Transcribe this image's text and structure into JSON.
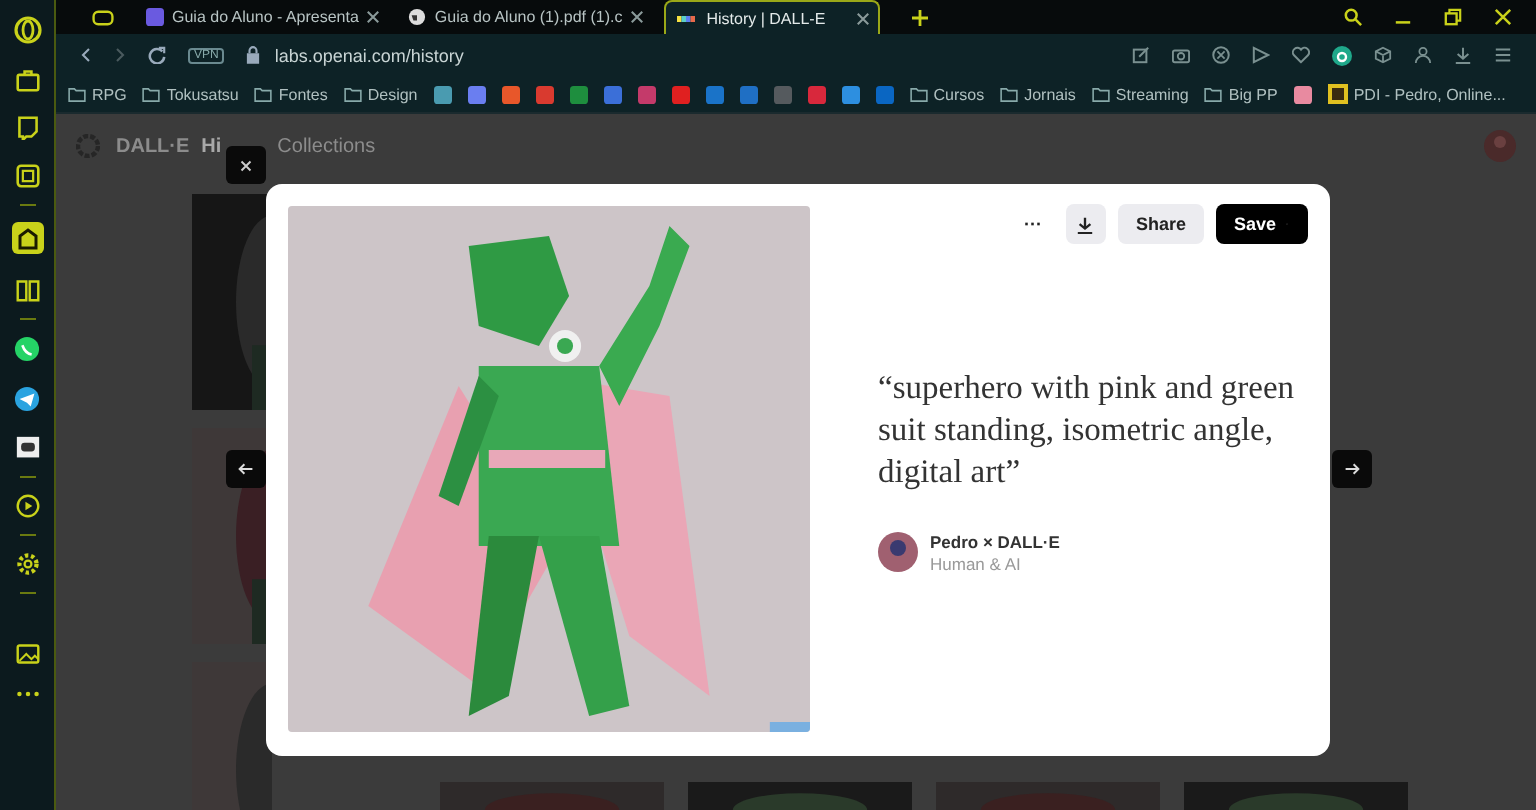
{
  "sidebar": {
    "items": [
      {
        "kind": "browser",
        "selected": false
      },
      {
        "kind": "bag",
        "selected": false
      },
      {
        "kind": "chat",
        "selected": false
      },
      {
        "kind": "box",
        "selected": false
      },
      {
        "kind": "home",
        "selected": true
      },
      {
        "kind": "book",
        "selected": false
      },
      {
        "kind": "whatsapp",
        "selected": false
      },
      {
        "kind": "telegram",
        "selected": false
      },
      {
        "kind": "discord",
        "selected": false
      },
      {
        "kind": "play",
        "selected": false
      },
      {
        "kind": "gear",
        "selected": false
      },
      {
        "kind": "gallery",
        "selected": false
      },
      {
        "kind": "more",
        "selected": false
      }
    ]
  },
  "tabs": [
    {
      "title": "Guia do Aluno - Apresenta",
      "selected": false,
      "kind": "app"
    },
    {
      "title": "Guia do Aluno (1).pdf (1).c",
      "selected": false,
      "kind": "globe"
    },
    {
      "title": "History | DALL-E",
      "selected": true,
      "kind": "dalle"
    }
  ],
  "address_bar": {
    "url": "labs.openai.com/history",
    "badge": "VPN"
  },
  "bookmarks": [
    {
      "kind": "folder",
      "label": "RPG"
    },
    {
      "kind": "folder",
      "label": "Tokusatsu"
    },
    {
      "kind": "folder",
      "label": "Fontes"
    },
    {
      "kind": "folder",
      "label": "Design"
    },
    {
      "kind": "site",
      "color": "#4a9bb0"
    },
    {
      "kind": "site",
      "color": "#6a7ef0"
    },
    {
      "kind": "site",
      "color": "#e8572a"
    },
    {
      "kind": "site",
      "color": "#d93a2f"
    },
    {
      "kind": "site",
      "color": "#1e8e3e"
    },
    {
      "kind": "site",
      "color": "#3b6fd8"
    },
    {
      "kind": "site",
      "color": "#c43a6a"
    },
    {
      "kind": "site",
      "color": "#e02020"
    },
    {
      "kind": "site",
      "color": "#1a73c8"
    },
    {
      "kind": "site",
      "color": "#1f6fc4"
    },
    {
      "kind": "site",
      "color": "#555a5e"
    },
    {
      "kind": "site",
      "color": "#d8283c"
    },
    {
      "kind": "site",
      "color": "#2d8fe0"
    },
    {
      "kind": "site",
      "color": "#0a66c2"
    },
    {
      "kind": "folder",
      "label": "Cursos"
    },
    {
      "kind": "folder",
      "label": "Jornais"
    },
    {
      "kind": "folder",
      "label": "Streaming"
    },
    {
      "kind": "folder",
      "label": "Big PP"
    },
    {
      "kind": "site",
      "color": "#e88aa0"
    },
    {
      "kind": "page",
      "label": "PDI - Pedro, Online..."
    }
  ],
  "page": {
    "brand": "DALL·E",
    "nav": [
      {
        "label": "Hi",
        "selected": true
      },
      {
        "label": "Collections",
        "selected": false
      }
    ]
  },
  "modal": {
    "more": "···",
    "share": "Share",
    "save": "Save",
    "prompt": "“superhero with pink and green suit standing, isometric angle, digital art”",
    "author": "Pedro × DALL·E",
    "subtitle": "Human & AI"
  }
}
